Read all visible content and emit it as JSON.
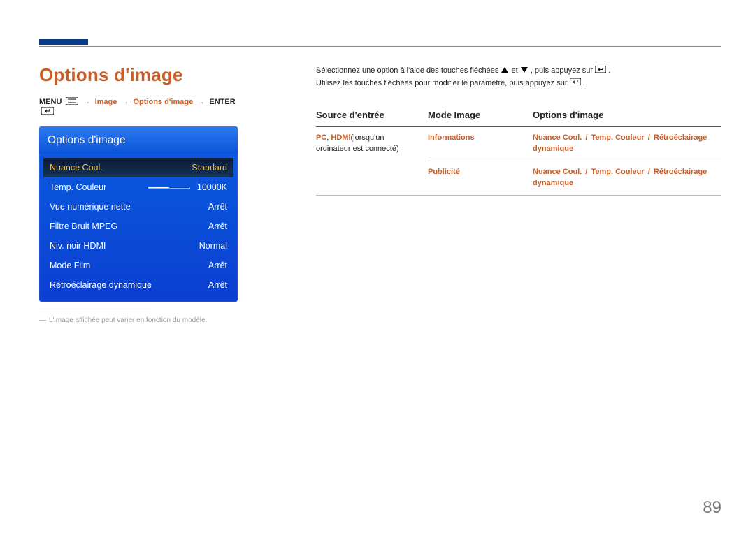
{
  "page": {
    "title": "Options d'image",
    "number": "89"
  },
  "breadcrumb": {
    "menu": "MENU",
    "seg1": "Image",
    "seg2": "Options d'image",
    "enter": "ENTER"
  },
  "osd": {
    "header": "Options d'image",
    "rows": [
      {
        "label": "Nuance Coul.",
        "value": "Standard",
        "selected": true
      },
      {
        "label": "Temp. Couleur",
        "value": "10000K",
        "slider": true
      },
      {
        "label": "Vue numérique nette",
        "value": "Arrêt"
      },
      {
        "label": "Filtre Bruit MPEG",
        "value": "Arrêt"
      },
      {
        "label": "Niv. noir HDMI",
        "value": "Normal"
      },
      {
        "label": "Mode Film",
        "value": "Arrêt"
      },
      {
        "label": "Rétroéclairage dynamique",
        "value": "Arrêt"
      }
    ]
  },
  "caption": "L'image affichée peut varier en fonction du modèle.",
  "instructions": {
    "line1_a": "Sélectionnez une option à l'aide des touches fléchées ",
    "line1_b": " et ",
    "line1_c": ", puis appuyez sur ",
    "line1_d": ".",
    "line2_a": "Utilisez les touches fléchées pour modifier le paramètre, puis appuyez sur ",
    "line2_b": "."
  },
  "table": {
    "headers": {
      "c1": "Source d'entrée",
      "c2": "Mode Image",
      "c3": "Options d'image"
    },
    "rows": [
      {
        "c1": {
          "highlight1": "PC",
          "comma": ", ",
          "highlight2": "HDMI",
          "plain": "(lorsqu'un ordinateur est connecté)"
        },
        "c2": "Informations",
        "c3": {
          "p1": "Nuance Coul.",
          "p2": "Temp. Couleur",
          "p3": "Rétroéclairage dynamique"
        }
      },
      {
        "c2": "Publicité",
        "c3": {
          "p1": "Nuance Coul.",
          "p2": "Temp. Couleur",
          "p3": "Rétroéclairage dynamique"
        }
      }
    ]
  }
}
